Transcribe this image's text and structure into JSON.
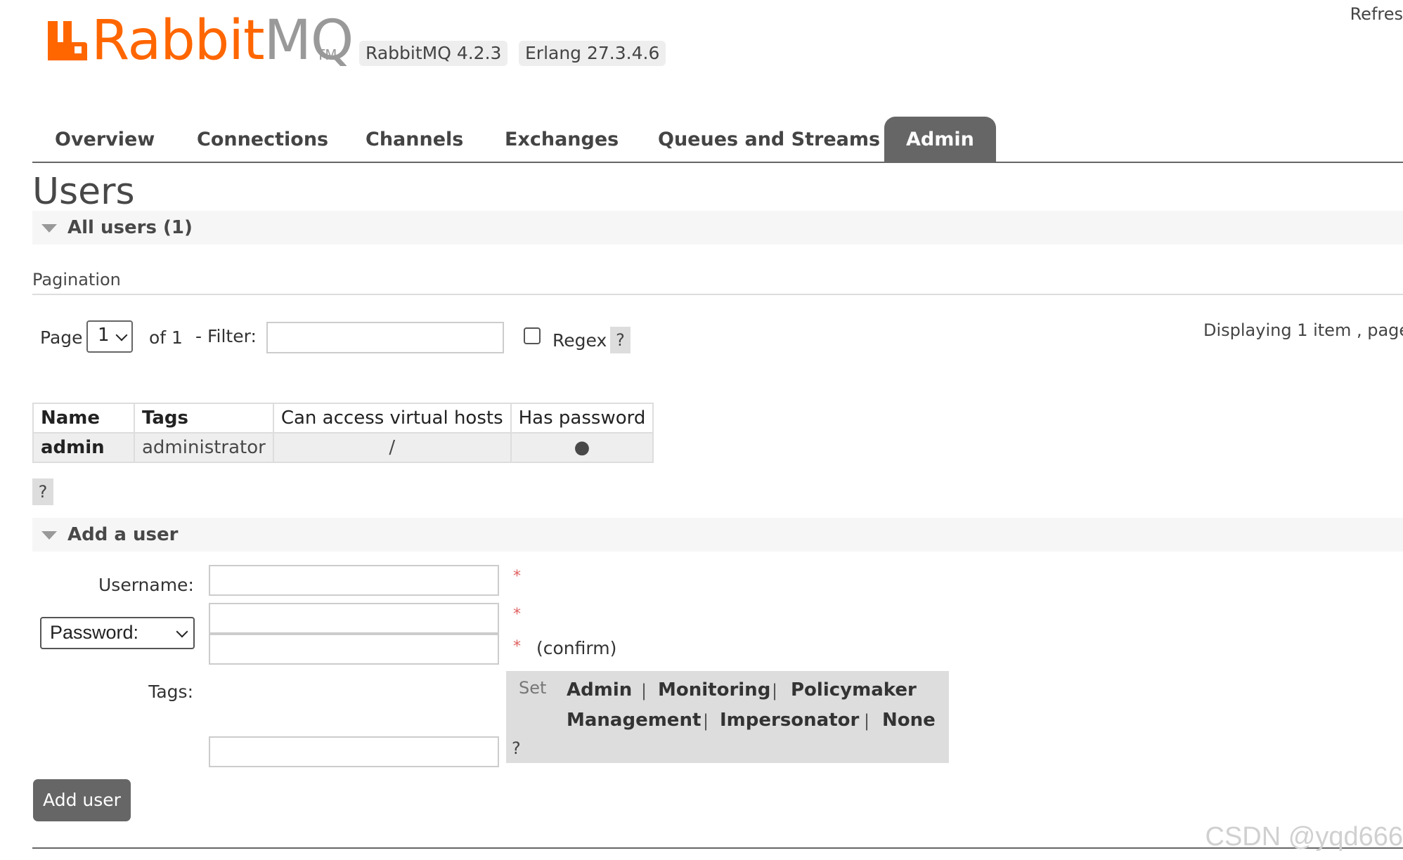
{
  "brand": {
    "logo_main": "Rabbit",
    "logo_mq": "MQ",
    "logo_tm": "TM",
    "rabbitmq_version": "RabbitMQ 4.2.3",
    "erlang_version": "Erlang 27.3.4.6",
    "color_orange": "#ff6600"
  },
  "header": {
    "refresh_label": "Refres"
  },
  "nav": {
    "tabs": [
      {
        "label": "Overview"
      },
      {
        "label": "Connections"
      },
      {
        "label": "Channels"
      },
      {
        "label": "Exchanges"
      },
      {
        "label": "Queues and Streams"
      },
      {
        "label": "Admin",
        "active": true
      }
    ]
  },
  "page": {
    "title": "Users"
  },
  "all_users": {
    "heading": "All users (1)",
    "pagination": {
      "heading": "Pagination",
      "page_label": "Page",
      "page_value": "1",
      "of_label": "of 1",
      "filter_label": "- Filter:",
      "filter_value": "",
      "regex_label": "Regex",
      "regex_checked": false,
      "help": "?",
      "displaying": "Displaying 1 item , page"
    },
    "table": {
      "headers": [
        "Name",
        "Tags",
        "Can access virtual hosts",
        "Has password"
      ],
      "rows": [
        {
          "name": "admin",
          "tags": "administrator",
          "vhosts": "/",
          "has_password": "●"
        }
      ]
    },
    "help": "?"
  },
  "add_user": {
    "heading": "Add a user",
    "username_label": "Username:",
    "password_type": "Password:",
    "required_mark": "*",
    "confirm_label": "(confirm)",
    "tags_label": "Tags:",
    "set_label": "Set",
    "tag_options": [
      "Admin",
      "Monitoring",
      "Policymaker",
      "Management",
      "Impersonator",
      "None"
    ],
    "separator": "|",
    "help": "?",
    "submit_label": "Add user"
  },
  "watermark": "CSDN @yqd666"
}
